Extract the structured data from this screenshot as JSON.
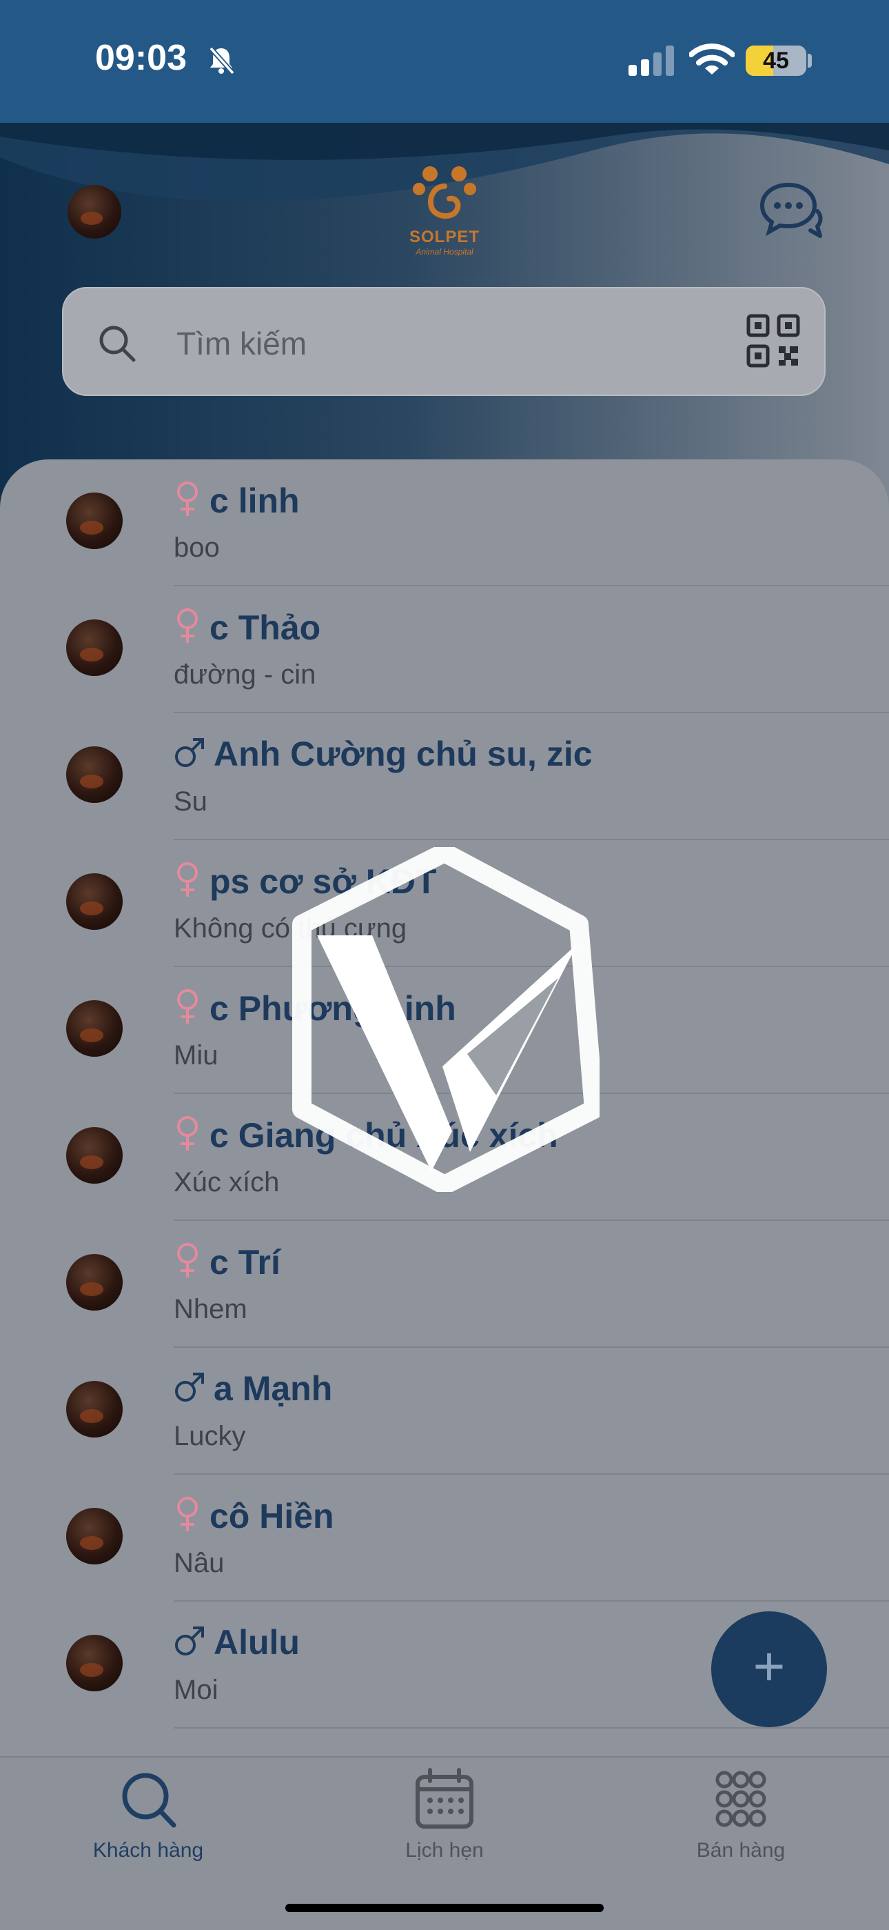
{
  "status_bar": {
    "time": "09:03",
    "battery": "45",
    "battery_level": 0.45
  },
  "header": {
    "logo_brand": "SOLPET",
    "logo_sub": "Animal Hospital",
    "search_placeholder": "Tìm kiếm"
  },
  "customers": [
    {
      "name": "c linh",
      "gender": "female",
      "pet": "boo"
    },
    {
      "name": "c Thảo",
      "gender": "female",
      "pet": "đường - cin"
    },
    {
      "name": "Anh Cường chủ su, zic",
      "gender": "male",
      "pet": "Su"
    },
    {
      "name": "ps cơ sở KĐT",
      "gender": "female",
      "pet": "Không có thú cưng"
    },
    {
      "name": "c Phương Linh",
      "gender": "female",
      "pet": "Miu"
    },
    {
      "name": "c Giang chủ Xúc xích",
      "gender": "female",
      "pet": "Xúc xích"
    },
    {
      "name": "c Trí",
      "gender": "female",
      "pet": "Nhem"
    },
    {
      "name": "a Mạnh",
      "gender": "male",
      "pet": "Lucky"
    },
    {
      "name": "cô Hiền",
      "gender": "female",
      "pet": "Nâu"
    },
    {
      "name": "Alulu",
      "gender": "male",
      "pet": "Moi"
    }
  ],
  "fab_label": "+",
  "tabs": [
    {
      "label": "Khách hàng",
      "icon": "search-icon",
      "active": true
    },
    {
      "label": "Lịch hẹn",
      "icon": "calendar-icon",
      "active": false
    },
    {
      "label": "Bán hàng",
      "icon": "grid-icon",
      "active": false
    }
  ],
  "colors": {
    "status_bar": "#245887",
    "primary_dark": "#1d3a5c",
    "female": "#e48a9c",
    "male": "#1d3a5c",
    "fab": "#1b3c5e"
  }
}
